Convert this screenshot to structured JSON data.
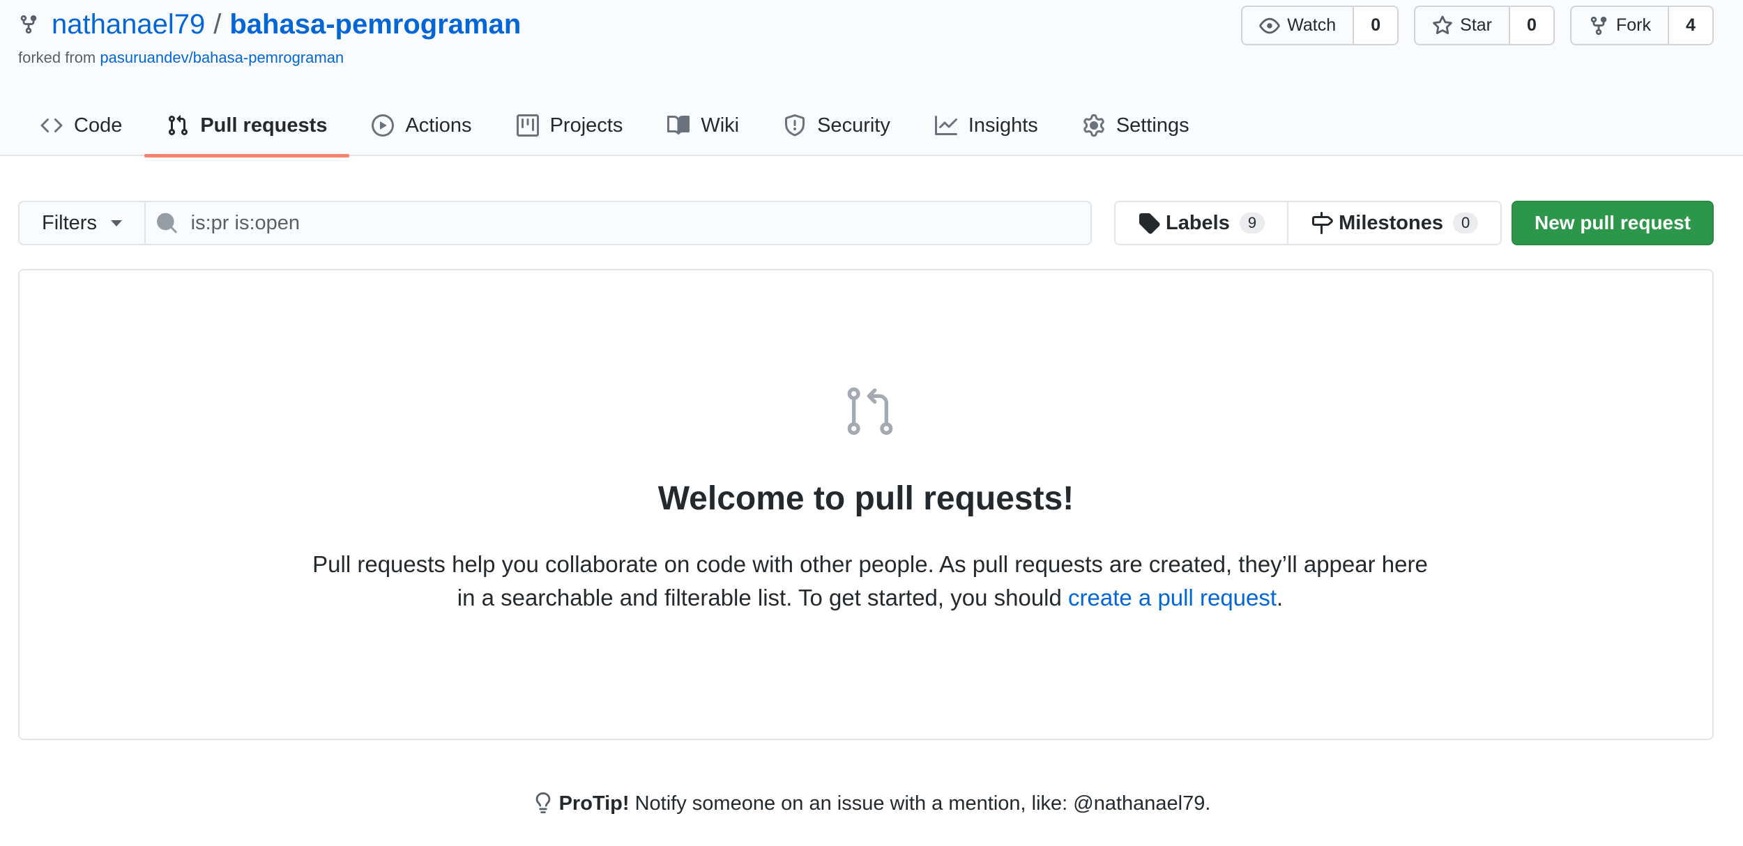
{
  "repo": {
    "owner": "nathanael79",
    "separator": "/",
    "name": "bahasa-pemrograman",
    "forked_prefix": "forked from",
    "forked_source": "pasuruandev/bahasa-pemrograman"
  },
  "actions": {
    "watch_label": "Watch",
    "watch_count": "0",
    "star_label": "Star",
    "star_count": "0",
    "fork_label": "Fork",
    "fork_count": "4"
  },
  "tabs": [
    {
      "label": "Code",
      "icon": "code-icon",
      "selected": false
    },
    {
      "label": "Pull requests",
      "icon": "git-pull-request-icon",
      "selected": true
    },
    {
      "label": "Actions",
      "icon": "play-icon",
      "selected": false
    },
    {
      "label": "Projects",
      "icon": "project-icon",
      "selected": false
    },
    {
      "label": "Wiki",
      "icon": "book-icon",
      "selected": false
    },
    {
      "label": "Security",
      "icon": "shield-icon",
      "selected": false
    },
    {
      "label": "Insights",
      "icon": "graph-icon",
      "selected": false
    },
    {
      "label": "Settings",
      "icon": "gear-icon",
      "selected": false
    }
  ],
  "subnav": {
    "filters_label": "Filters",
    "search_value": "is:pr is:open",
    "labels_label": "Labels",
    "labels_count": "9",
    "milestones_label": "Milestones",
    "milestones_count": "0",
    "new_pr_label": "New pull request"
  },
  "blankslate": {
    "icon": "git-pull-request-icon",
    "title": "Welcome to pull requests!",
    "desc_before": "Pull requests help you collaborate on code with other people. As pull requests are created, they’ll appear here in a searchable and filterable list. To get started, you should ",
    "desc_link": "create a pull request",
    "desc_after": "."
  },
  "protip": {
    "icon": "light-bulb-icon",
    "label": "ProTip!",
    "text": " Notify someone on an issue with a mention, like: @nathanael79."
  },
  "colors": {
    "link": "#0366d6",
    "primary_button": "#2c974b",
    "selected_tab_underline": "#f9826c"
  }
}
